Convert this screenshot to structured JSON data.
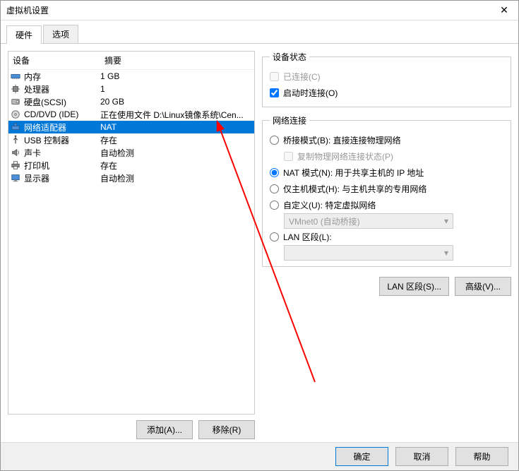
{
  "window": {
    "title": "虚拟机设置"
  },
  "tabs": {
    "hardware": "硬件",
    "options": "选项",
    "active": "hardware"
  },
  "list": {
    "header_device": "设备",
    "header_summary": "摘要",
    "rows": [
      {
        "id": "memory",
        "icon": "memory-icon",
        "name": "内存",
        "summary": "1 GB"
      },
      {
        "id": "cpu",
        "icon": "cpu-icon",
        "name": "处理器",
        "summary": "1"
      },
      {
        "id": "hdd",
        "icon": "hdd-icon",
        "name": "硬盘(SCSI)",
        "summary": "20 GB"
      },
      {
        "id": "cddvd",
        "icon": "disc-icon",
        "name": "CD/DVD (IDE)",
        "summary": "正在使用文件 D:\\Linux镜像系统\\Cen..."
      },
      {
        "id": "network",
        "icon": "network-icon",
        "name": "网络适配器",
        "summary": "NAT",
        "selected": true
      },
      {
        "id": "usb",
        "icon": "usb-icon",
        "name": "USB 控制器",
        "summary": "存在"
      },
      {
        "id": "sound",
        "icon": "sound-icon",
        "name": "声卡",
        "summary": "自动检测"
      },
      {
        "id": "printer",
        "icon": "printer-icon",
        "name": "打印机",
        "summary": "存在"
      },
      {
        "id": "display",
        "icon": "display-icon",
        "name": "显示器",
        "summary": "自动检测"
      }
    ]
  },
  "left_buttons": {
    "add": "添加(A)...",
    "remove": "移除(R)"
  },
  "device_status": {
    "legend": "设备状态",
    "connected": {
      "label": "已连接(C)",
      "checked": false,
      "enabled": false
    },
    "connect_on_power": {
      "label": "启动时连接(O)",
      "checked": true,
      "enabled": true
    }
  },
  "network": {
    "legend": "网络连接",
    "bridged": {
      "label": "桥接模式(B): 直接连接物理网络"
    },
    "replicate": {
      "label": "复制物理网络连接状态(P)",
      "enabled": false
    },
    "nat": {
      "label": "NAT 模式(N): 用于共享主机的 IP 地址",
      "selected": true
    },
    "hostonly": {
      "label": "仅主机模式(H): 与主机共享的专用网络"
    },
    "custom": {
      "label": "自定义(U): 特定虚拟网络"
    },
    "custom_dropdown": {
      "value": "VMnet0 (自动桥接)",
      "enabled": false
    },
    "lan": {
      "label": "LAN 区段(L):"
    },
    "lan_dropdown": {
      "value": "",
      "enabled": false
    }
  },
  "right_buttons": {
    "lan_segment": "LAN 区段(S)...",
    "advanced": "高级(V)..."
  },
  "footer": {
    "ok": "确定",
    "cancel": "取消",
    "help": "帮助"
  },
  "colors": {
    "selection": "#0078d7",
    "arrow": "#ff0000"
  }
}
